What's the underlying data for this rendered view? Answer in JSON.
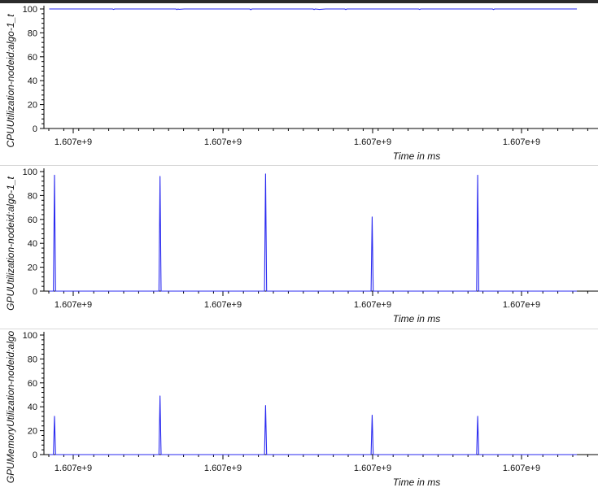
{
  "colors": {
    "series": "#2a2af0",
    "axis": "#000000",
    "text": "#111111"
  },
  "chart_data": [
    {
      "type": "line",
      "ylabel": "CPUUtilization-nodeid:algo-1_t",
      "xlabel": "Time in ms",
      "ylim": [
        0,
        100
      ],
      "yticks": [
        "0",
        "20",
        "40",
        "60",
        "80",
        "100"
      ],
      "xticks": [
        "1.607e+9",
        "1.607e+9",
        "1.607e+9",
        "1.607e+9"
      ],
      "grid": false,
      "series": [
        {
          "x": [
            0,
            60,
            61,
            62,
            66,
            120,
            121,
            122,
            123,
            128,
            190,
            191,
            192,
            196,
            250,
            251,
            252,
            256,
            262,
            280,
            281,
            282,
            350,
            351,
            352,
            355,
            420,
            421,
            422,
            424,
            500
          ],
          "values": [
            100,
            100,
            99.6,
            100,
            100,
            100,
            99.5,
            100,
            99.7,
            100,
            100,
            99.4,
            100,
            100,
            100,
            99.5,
            100,
            99.6,
            100,
            100,
            99.5,
            100,
            100,
            99.6,
            100,
            100,
            100,
            99.5,
            100,
            100,
            100
          ]
        }
      ]
    },
    {
      "type": "line",
      "ylabel": "GPUUtilization-nodeid:algo-1_t",
      "xlabel": "Time in ms",
      "ylim": [
        0,
        100
      ],
      "yticks": [
        "0",
        "20",
        "40",
        "60",
        "80",
        "100"
      ],
      "xticks": [
        "1.607e+9",
        "1.607e+9",
        "1.607e+9",
        "1.607e+9"
      ],
      "grid": false,
      "series": [
        {
          "x": [
            0,
            4,
            5,
            6,
            7,
            104,
            105,
            106,
            107,
            204,
            205,
            206,
            207,
            305,
            306,
            307,
            308,
            405,
            406,
            407,
            408,
            500
          ],
          "values": [
            0,
            0,
            97,
            0,
            0,
            0,
            96,
            0,
            0,
            0,
            98,
            0,
            0,
            0,
            62,
            0,
            0,
            0,
            97,
            0,
            0,
            0
          ]
        }
      ]
    },
    {
      "type": "line",
      "ylabel": "GPUMemoryUtilization-nodeid:algo",
      "xlabel": "Time in ms",
      "ylim": [
        0,
        100
      ],
      "yticks": [
        "0",
        "20",
        "40",
        "60",
        "80",
        "100"
      ],
      "xticks": [
        "1.607e+9",
        "1.607e+9",
        "1.607e+9",
        "1.607e+9"
      ],
      "grid": false,
      "series": [
        {
          "x": [
            0,
            4,
            5,
            6,
            7,
            104,
            105,
            106,
            107,
            204,
            205,
            206,
            207,
            305,
            306,
            307,
            308,
            405,
            406,
            407,
            408,
            500
          ],
          "values": [
            0,
            0,
            32,
            0,
            0,
            0,
            49,
            0,
            0,
            0,
            41,
            0,
            0,
            0,
            33,
            0,
            0,
            0,
            32,
            0,
            0,
            0
          ]
        }
      ]
    }
  ]
}
